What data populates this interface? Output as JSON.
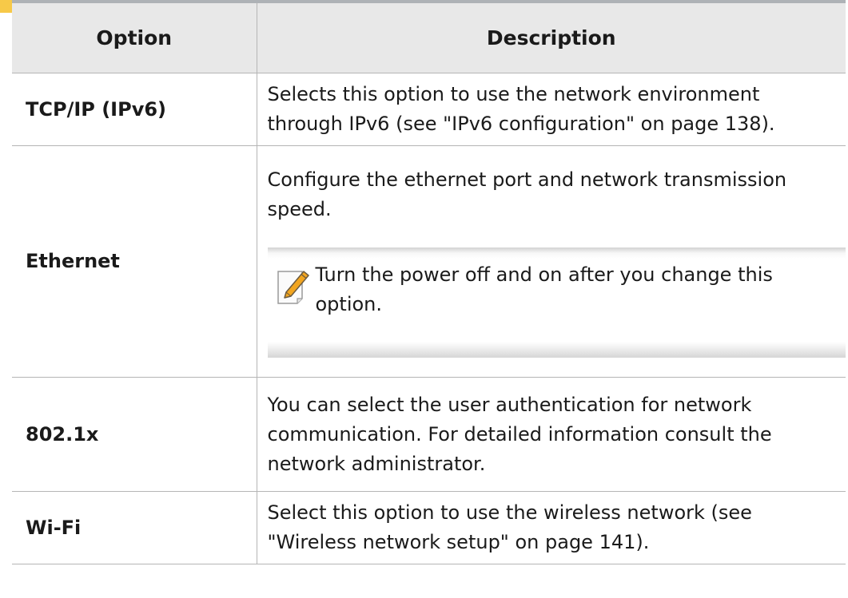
{
  "table": {
    "headers": {
      "option": "Option",
      "description": "Description"
    },
    "rows": [
      {
        "option": "TCP/IP (IPv6)",
        "description": "Selects this option to use the network environment through IPv6 (see \"IPv6 configuration\" on page 138)."
      },
      {
        "option": "Ethernet",
        "description": "Configure the ethernet port and network transmission speed.",
        "note": "Turn the power off and on after you change this option."
      },
      {
        "option": "802.1x",
        "description": "You can select the user authentication for network communication. For detailed information consult the network administrator."
      },
      {
        "option": "Wi-Fi",
        "description": "Select this option to use the wireless network (see \"Wireless network setup\" on page 141)."
      }
    ]
  },
  "note_icon": "note-pencil-icon",
  "colors": {
    "header_background": "#e8e8e8",
    "header_top_rule": "#aeb2b6",
    "grid_line": "#b5b5b5",
    "edge_mark": "#f7c948",
    "note_icon_accent": "#f2a51f"
  }
}
